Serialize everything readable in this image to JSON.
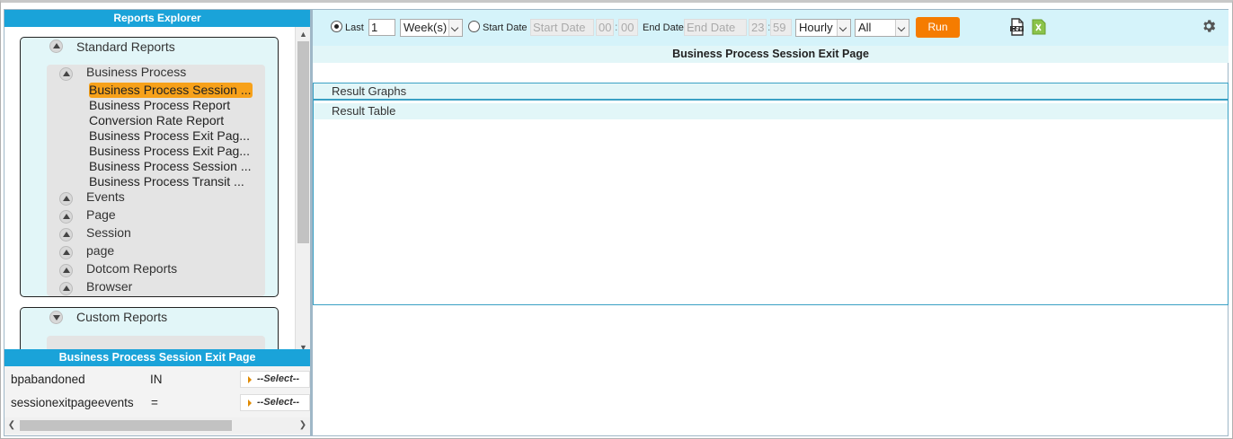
{
  "explorer": {
    "title": "Reports Explorer",
    "standard": {
      "label": "Standard Reports",
      "groups": [
        {
          "label": "Business Process",
          "items": [
            "Business Process Session ...",
            "Business Process Report",
            "Conversion Rate Report",
            "Business Process Exit Pag...",
            "Business Process Exit Pag...",
            "Business Process Session ...",
            "Business Process Transit ..."
          ]
        },
        {
          "label": "Events"
        },
        {
          "label": "Page"
        },
        {
          "label": "Session"
        },
        {
          "label": "page"
        },
        {
          "label": "Dotcom Reports"
        },
        {
          "label": "Browser"
        }
      ]
    },
    "custom": {
      "label": "Custom Reports"
    }
  },
  "params": {
    "title": "Business Process Session Exit Page",
    "rows": [
      {
        "name": "bpabandoned",
        "op": "IN",
        "select": "--Select--"
      },
      {
        "name": "sessionexitpageevents",
        "op": "=",
        "select": "--Select--"
      }
    ]
  },
  "toolbar": {
    "last_label": "Last",
    "last_value": "1",
    "period": "Week(s)",
    "start_label": "Start Date",
    "start_placeholder": "Start Date",
    "start_hh": "00",
    "start_mm": "00",
    "end_label": "End Date",
    "end_placeholder": "End Date",
    "end_hh": "23",
    "end_mm": "59",
    "granularity": "Hourly",
    "filter": "All",
    "run_label": "Run",
    "selected_mode": "last"
  },
  "main": {
    "page_title": "Business Process Session Exit Page",
    "result_graphs": "Result Graphs",
    "result_table": "Result Table"
  },
  "colors": {
    "header_blue": "#1aa3d9",
    "run_orange": "#f57c00",
    "active_item": "#f7a11a",
    "panel_tint": "#e2f6f8"
  }
}
